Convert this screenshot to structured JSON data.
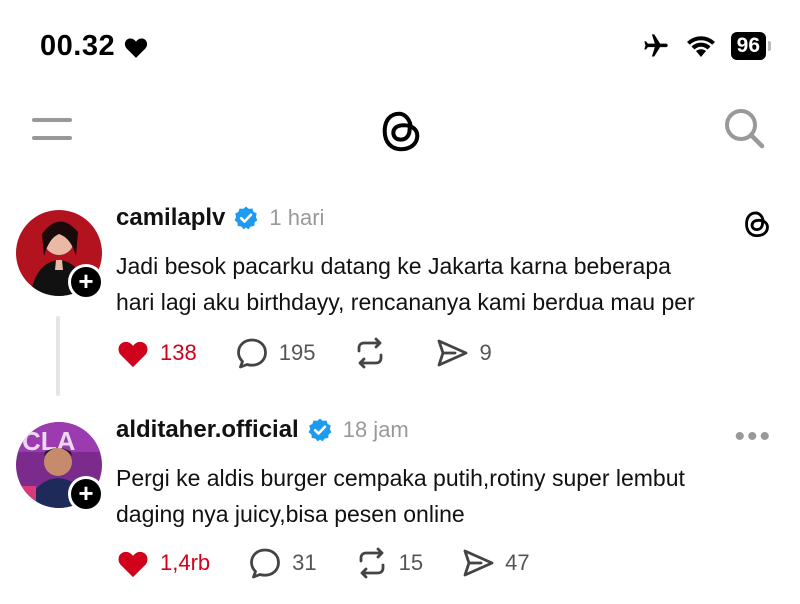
{
  "status_bar": {
    "time": "00.32",
    "battery": "96"
  },
  "posts": [
    {
      "username": "camilaplv",
      "time_ago": "1 hari",
      "text": "Jadi besok pacarku datang ke Jakarta karna beberapa hari lagi aku birthdayy, rencananya kami berdua mau per",
      "line1": "Jadi besok pacarku datang ke Jakarta karna beberapa",
      "line2": "hari lagi aku birthdayy, rencananya kami berdua mau per",
      "likes": "138",
      "comments": "195",
      "reposts": "",
      "shares": "9"
    },
    {
      "username": "alditaher.official",
      "time_ago": "18 jam",
      "line1": "Pergi ke aldis burger cempaka putih,rotiny super lembut",
      "line2": "daging nya juicy,bisa pesen online",
      "likes": "1,4rb",
      "comments": "31",
      "reposts": "15",
      "shares": "47"
    }
  ],
  "colors": {
    "like_red": "#d0021b",
    "verified_blue": "#1d9bf0",
    "muted": "#999999"
  },
  "icons": [
    "heart-icon",
    "airplane-icon",
    "wifi-icon",
    "menu-icon",
    "threads-logo-icon",
    "search-icon",
    "verified-icon",
    "plus-icon",
    "comment-icon",
    "repost-icon",
    "share-icon",
    "more-icon"
  ]
}
